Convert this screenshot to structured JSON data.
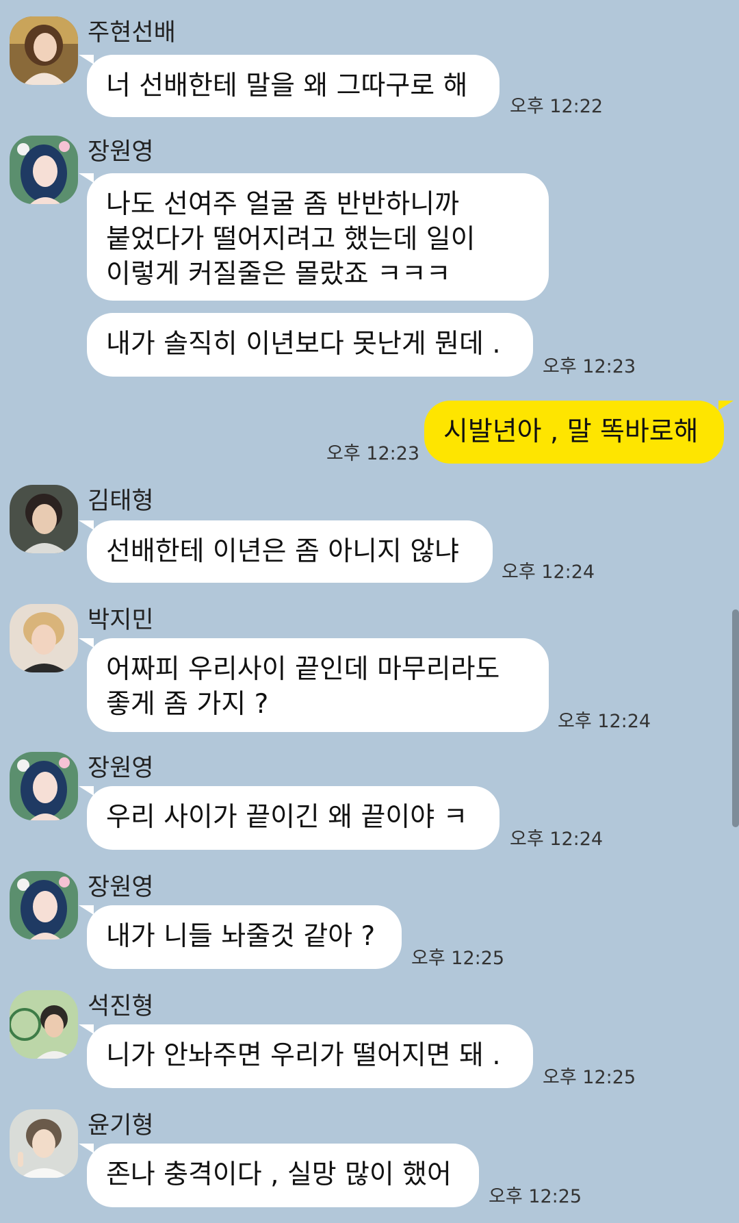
{
  "colors": {
    "background": "#b2c7d9",
    "incoming_bubble": "#ffffff",
    "outgoing_bubble": "#fee500"
  },
  "messages": [
    {
      "sender": "주현선배",
      "lines": [
        "너 선배한테 말을 왜 그따구로 해"
      ],
      "time": "오후 12:22",
      "avatar_icon": "woman-portrait-avatar"
    },
    {
      "sender": "장원영",
      "lines": [
        "나도 선여주 얼굴 좀 반반하니까",
        "붙었다가 떨어지려고 했는데 일이",
        "이렇게 커질줄은 몰랐죠 ㅋㅋㅋ"
      ],
      "time": "",
      "avatar_icon": "blue-hair-flower-avatar"
    },
    {
      "sender": "",
      "lines": [
        "내가 솔직히 이년보다 못난게 뭔데 ."
      ],
      "time": "오후 12:23",
      "avatar_icon": ""
    },
    {
      "sender": "me",
      "lines": [
        "시발년아 , 말 똑바로해"
      ],
      "time": "오후 12:23",
      "avatar_icon": ""
    },
    {
      "sender": "김태형",
      "lines": [
        "선배한테 이년은 좀 아니지 않냐"
      ],
      "time": "오후 12:24",
      "avatar_icon": "man-portrait-avatar"
    },
    {
      "sender": "박지민",
      "lines": [
        "어짜피 우리사이 끝인데 마무리라도",
        "좋게 좀 가지 ?"
      ],
      "time": "오후 12:24",
      "avatar_icon": "blond-man-avatar"
    },
    {
      "sender": "장원영",
      "lines": [
        "우리 사이가 끝이긴 왜 끝이야 ㅋ"
      ],
      "time": "오후 12:24",
      "avatar_icon": "blue-hair-flower-avatar"
    },
    {
      "sender": "장원영",
      "lines": [
        "내가 니들 놔줄것 같아 ?"
      ],
      "time": "오후 12:25",
      "avatar_icon": "blue-hair-flower-avatar"
    },
    {
      "sender": "석진형",
      "lines": [
        "니가 안놔주면 우리가 떨어지면 돼 ."
      ],
      "time": "오후 12:25",
      "avatar_icon": "tennis-man-avatar"
    },
    {
      "sender": "윤기형",
      "lines": [
        "존나 충격이다 , 실망 많이 했어"
      ],
      "time": "오후 12:25",
      "avatar_icon": "peace-sign-man-avatar"
    }
  ]
}
